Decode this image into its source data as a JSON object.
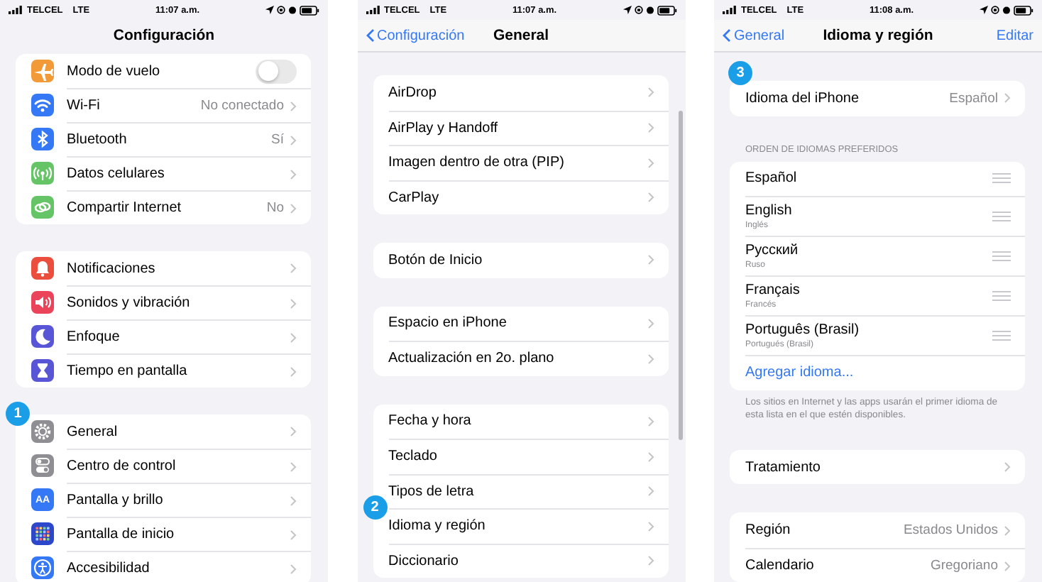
{
  "screens": [
    {
      "status_bar": {
        "carrier": "TELCEL",
        "network": "LTE",
        "time": "11:07 a.m."
      },
      "nav": {
        "title": "Configuración"
      },
      "groups": [
        {
          "rows": [
            {
              "kind": "toggle",
              "label": "Modo de vuelo",
              "on": false,
              "color": "#f19a37"
            },
            {
              "kind": "link",
              "label": "Wi-Fi",
              "value": "No conectado",
              "color": "#3478f6"
            },
            {
              "kind": "link",
              "label": "Bluetooth",
              "value": "Sí",
              "color": "#3478f6"
            },
            {
              "kind": "link",
              "label": "Datos celulares",
              "color": "#65c466"
            },
            {
              "kind": "link",
              "label": "Compartir Internet",
              "value": "No",
              "color": "#65c466"
            }
          ]
        },
        {
          "rows": [
            {
              "kind": "link",
              "label": "Notificaciones",
              "color": "#eb4e3d"
            },
            {
              "kind": "link",
              "label": "Sonidos y vibración",
              "color": "#eb445a"
            },
            {
              "kind": "link",
              "label": "Enfoque",
              "color": "#5856d6"
            },
            {
              "kind": "link",
              "label": "Tiempo en pantalla",
              "color": "#5856d6"
            }
          ]
        },
        {
          "rows": [
            {
              "kind": "link",
              "label": "General",
              "color": "#8e8e93",
              "badge": "1"
            },
            {
              "kind": "link",
              "label": "Centro de control",
              "color": "#8e8e93"
            },
            {
              "kind": "link",
              "label": "Pantalla y brillo",
              "color": "#3478f6",
              "icon_text": "AA"
            },
            {
              "kind": "link",
              "label": "Pantalla de inicio",
              "color": "#2c47c9"
            },
            {
              "kind": "link",
              "label": "Accesibilidad",
              "color": "#3478f6"
            }
          ]
        }
      ]
    },
    {
      "status_bar": {
        "carrier": "TELCEL",
        "network": "LTE",
        "time": "11:07 a.m."
      },
      "nav": {
        "back": "Configuración",
        "title": "General"
      },
      "groups": [
        {
          "rows": [
            {
              "kind": "link",
              "label": "AirDrop"
            },
            {
              "kind": "link",
              "label": "AirPlay y Handoff"
            },
            {
              "kind": "link",
              "label": "Imagen dentro de otra (PIP)"
            },
            {
              "kind": "link",
              "label": "CarPlay"
            }
          ]
        },
        {
          "rows": [
            {
              "kind": "link",
              "label": "Botón de Inicio"
            }
          ]
        },
        {
          "rows": [
            {
              "kind": "link",
              "label": "Espacio en iPhone"
            },
            {
              "kind": "link",
              "label": "Actualización en 2o. plano"
            }
          ]
        },
        {
          "rows": [
            {
              "kind": "link",
              "label": "Fecha y hora"
            },
            {
              "kind": "link",
              "label": "Teclado"
            },
            {
              "kind": "link",
              "label": "Tipos de letra"
            },
            {
              "kind": "link",
              "label": "Idioma y región",
              "badge": "2"
            },
            {
              "kind": "link",
              "label": "Diccionario"
            }
          ]
        }
      ]
    },
    {
      "status_bar": {
        "carrier": "TELCEL",
        "network": "LTE",
        "time": "11:08 a.m."
      },
      "nav": {
        "back": "General",
        "title": "Idioma y región",
        "action": "Editar"
      },
      "groups": [
        {
          "rows": [
            {
              "kind": "link",
              "label": "Idioma del iPhone",
              "value": "Español",
              "badge": "3"
            }
          ]
        },
        {
          "header": "ORDEN DE IDIOMAS PREFERIDOS",
          "footer": "Los sitios en Internet y las apps usarán el primer idioma de esta lista en el que estén disponibles.",
          "rows": [
            {
              "kind": "language",
              "label": "Español"
            },
            {
              "kind": "language",
              "label": "English",
              "subtitle": "Inglés"
            },
            {
              "kind": "language",
              "label": "Русский",
              "subtitle": "Ruso"
            },
            {
              "kind": "language",
              "label": "Français",
              "subtitle": "Francés"
            },
            {
              "kind": "language",
              "label": "Português (Brasil)",
              "subtitle": "Portugués (Brasil)"
            },
            {
              "kind": "add",
              "label": "Agregar idioma..."
            }
          ]
        },
        {
          "rows": [
            {
              "kind": "link",
              "label": "Tratamiento"
            }
          ]
        },
        {
          "rows": [
            {
              "kind": "link",
              "label": "Región",
              "value": "Estados Unidos"
            },
            {
              "kind": "link",
              "label": "Calendario",
              "value": "Gregoriano"
            }
          ]
        }
      ]
    }
  ]
}
